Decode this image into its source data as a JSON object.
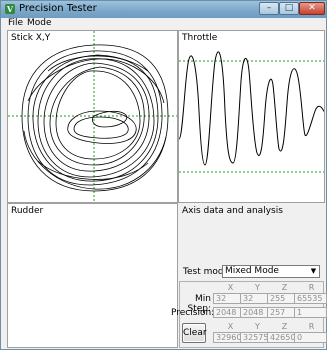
{
  "window": {
    "title": "Precision Tester",
    "app_icon_glyph": "V",
    "min_glyph": "–",
    "max_glyph": "□",
    "close_glyph": "✕"
  },
  "menu": {
    "file": "File",
    "mode": "Mode"
  },
  "panels": {
    "stick": "Stick X,Y",
    "throttle": "Throttle",
    "rudder": "Rudder"
  },
  "analysis": {
    "title": "Axis data and analysis",
    "test_mode_label": "Test mode:",
    "test_mode_value": "Mixed Mode",
    "columns": [
      "X",
      "Y",
      "Z",
      "R"
    ],
    "min_step_label": "Min Step:",
    "min_step": [
      "32",
      "32",
      "255",
      "65535"
    ],
    "precision_label": "Precision:",
    "precision": [
      "2048",
      "2048",
      "257",
      "1"
    ],
    "current": [
      "32960",
      "32575",
      "42650",
      "0"
    ],
    "clear_label": "Clear"
  },
  "colors": {
    "guide_green": "#18a018",
    "trace": "#000000"
  }
}
